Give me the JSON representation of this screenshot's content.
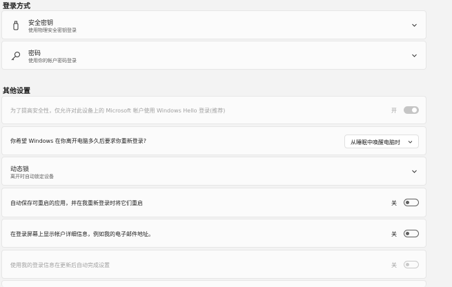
{
  "signin": {
    "section_title": "登录方式",
    "security_key": {
      "title": "安全密钥",
      "subtitle": "使用物理安全密钥登录",
      "icon": "usb-key-icon"
    },
    "password": {
      "title": "密码",
      "subtitle": "使用你的帐户密码登录",
      "icon": "key-icon"
    }
  },
  "other": {
    "section_title": "其他设置",
    "hello_only": {
      "title": "为了提高安全性，仅允许对此设备上的 Microsoft 帐户使用 Windows Hello 登录(推荐)",
      "state_label": "开",
      "state": "on",
      "disabled": true
    },
    "require_signin": {
      "title": "你希望 Windows 在你离开电脑多久后要求你重新登录?",
      "selected": "从睡眠中唤醒电脑时"
    },
    "dynamic_lock": {
      "title": "动态锁",
      "subtitle": "离开时自动锁定设备"
    },
    "restart_apps": {
      "title": "自动保存可重启的应用，并在我重新登录时将它们重启",
      "state_label": "关",
      "state": "off"
    },
    "show_details": {
      "title": "在登录屏幕上显示帐户详细信息，例如我的电子邮件地址。",
      "state_label": "关",
      "state": "off"
    },
    "use_signin_info": {
      "title": "使用我的登录信息在更新后自动完成设置",
      "state_label": "关",
      "state": "off",
      "disabled": true
    }
  }
}
